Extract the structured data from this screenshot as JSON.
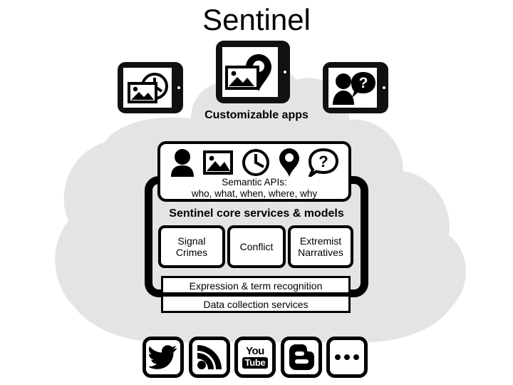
{
  "page": {
    "title": "Sentinel",
    "background_color": "#ffffff",
    "cloud_color": "#e4e4e4",
    "ink_color": "#000000"
  },
  "apps_layer": {
    "caption": "Customizable apps",
    "tablets": [
      {
        "name": "tablet-photo-clock",
        "icons": [
          "photo-icon",
          "clock-icon"
        ]
      },
      {
        "name": "tablet-photo-location",
        "icons": [
          "photo-icon",
          "location-pin-icon"
        ]
      },
      {
        "name": "tablet-person-question",
        "icons": [
          "person-icon",
          "question-speech-bubble-icon"
        ]
      }
    ]
  },
  "api_panel": {
    "icons": [
      "person-icon",
      "photo-icon",
      "clock-icon",
      "location-pin-icon",
      "question-speech-bubble-icon"
    ],
    "caption_line1": "Semantic APIs:",
    "caption_line2": "who, what, when, where, why"
  },
  "core": {
    "heading": "Sentinel core services & models",
    "boxes": [
      {
        "label": "Signal Crimes"
      },
      {
        "label": "Conflict"
      },
      {
        "label": "Extremist Narratives"
      }
    ]
  },
  "bars": {
    "expression": "Expression & term recognition",
    "data_collection": "Data collection services"
  },
  "sources": {
    "items": [
      {
        "name": "twitter-icon",
        "label": "Twitter"
      },
      {
        "name": "rss-icon",
        "label": "RSS"
      },
      {
        "name": "youtube-icon",
        "label_top": "You",
        "label_bottom": "Tube"
      },
      {
        "name": "blogger-icon",
        "label": "B"
      },
      {
        "name": "more-icon",
        "label": "..."
      }
    ]
  }
}
